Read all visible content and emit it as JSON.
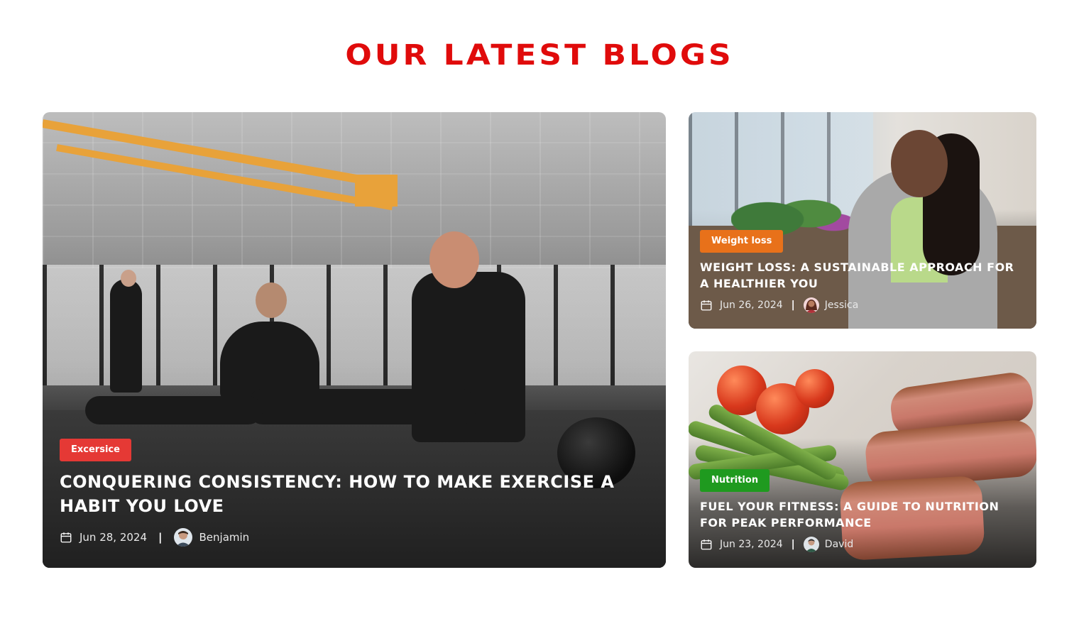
{
  "section": {
    "title": "OUR LATEST BLOGS"
  },
  "posts": [
    {
      "tag": "Excersice",
      "tag_color": "#e53935",
      "title": "CONQUERING CONSISTENCY: HOW TO MAKE EXERCISE A HABIT YOU LOVE",
      "date": "Jun 28, 2024",
      "author": "Benjamin",
      "image_icon": "gym-photo"
    },
    {
      "tag": "Weight loss",
      "tag_color": "#e8711a",
      "title": "WEIGHT LOSS: A SUSTAINABLE APPROACH FOR A HEALTHIER YOU",
      "date": "Jun 26, 2024",
      "author": "Jessica",
      "image_icon": "kitchen-photo"
    },
    {
      "tag": "Nutrition",
      "tag_color": "#1f9a1f",
      "title": "FUEL YOUR FITNESS: A GUIDE TO NUTRITION FOR PEAK PERFORMANCE",
      "date": "Jun 23, 2024",
      "author": "David",
      "image_icon": "food-photo"
    }
  ],
  "colors": {
    "accent": "#e00b0b"
  }
}
